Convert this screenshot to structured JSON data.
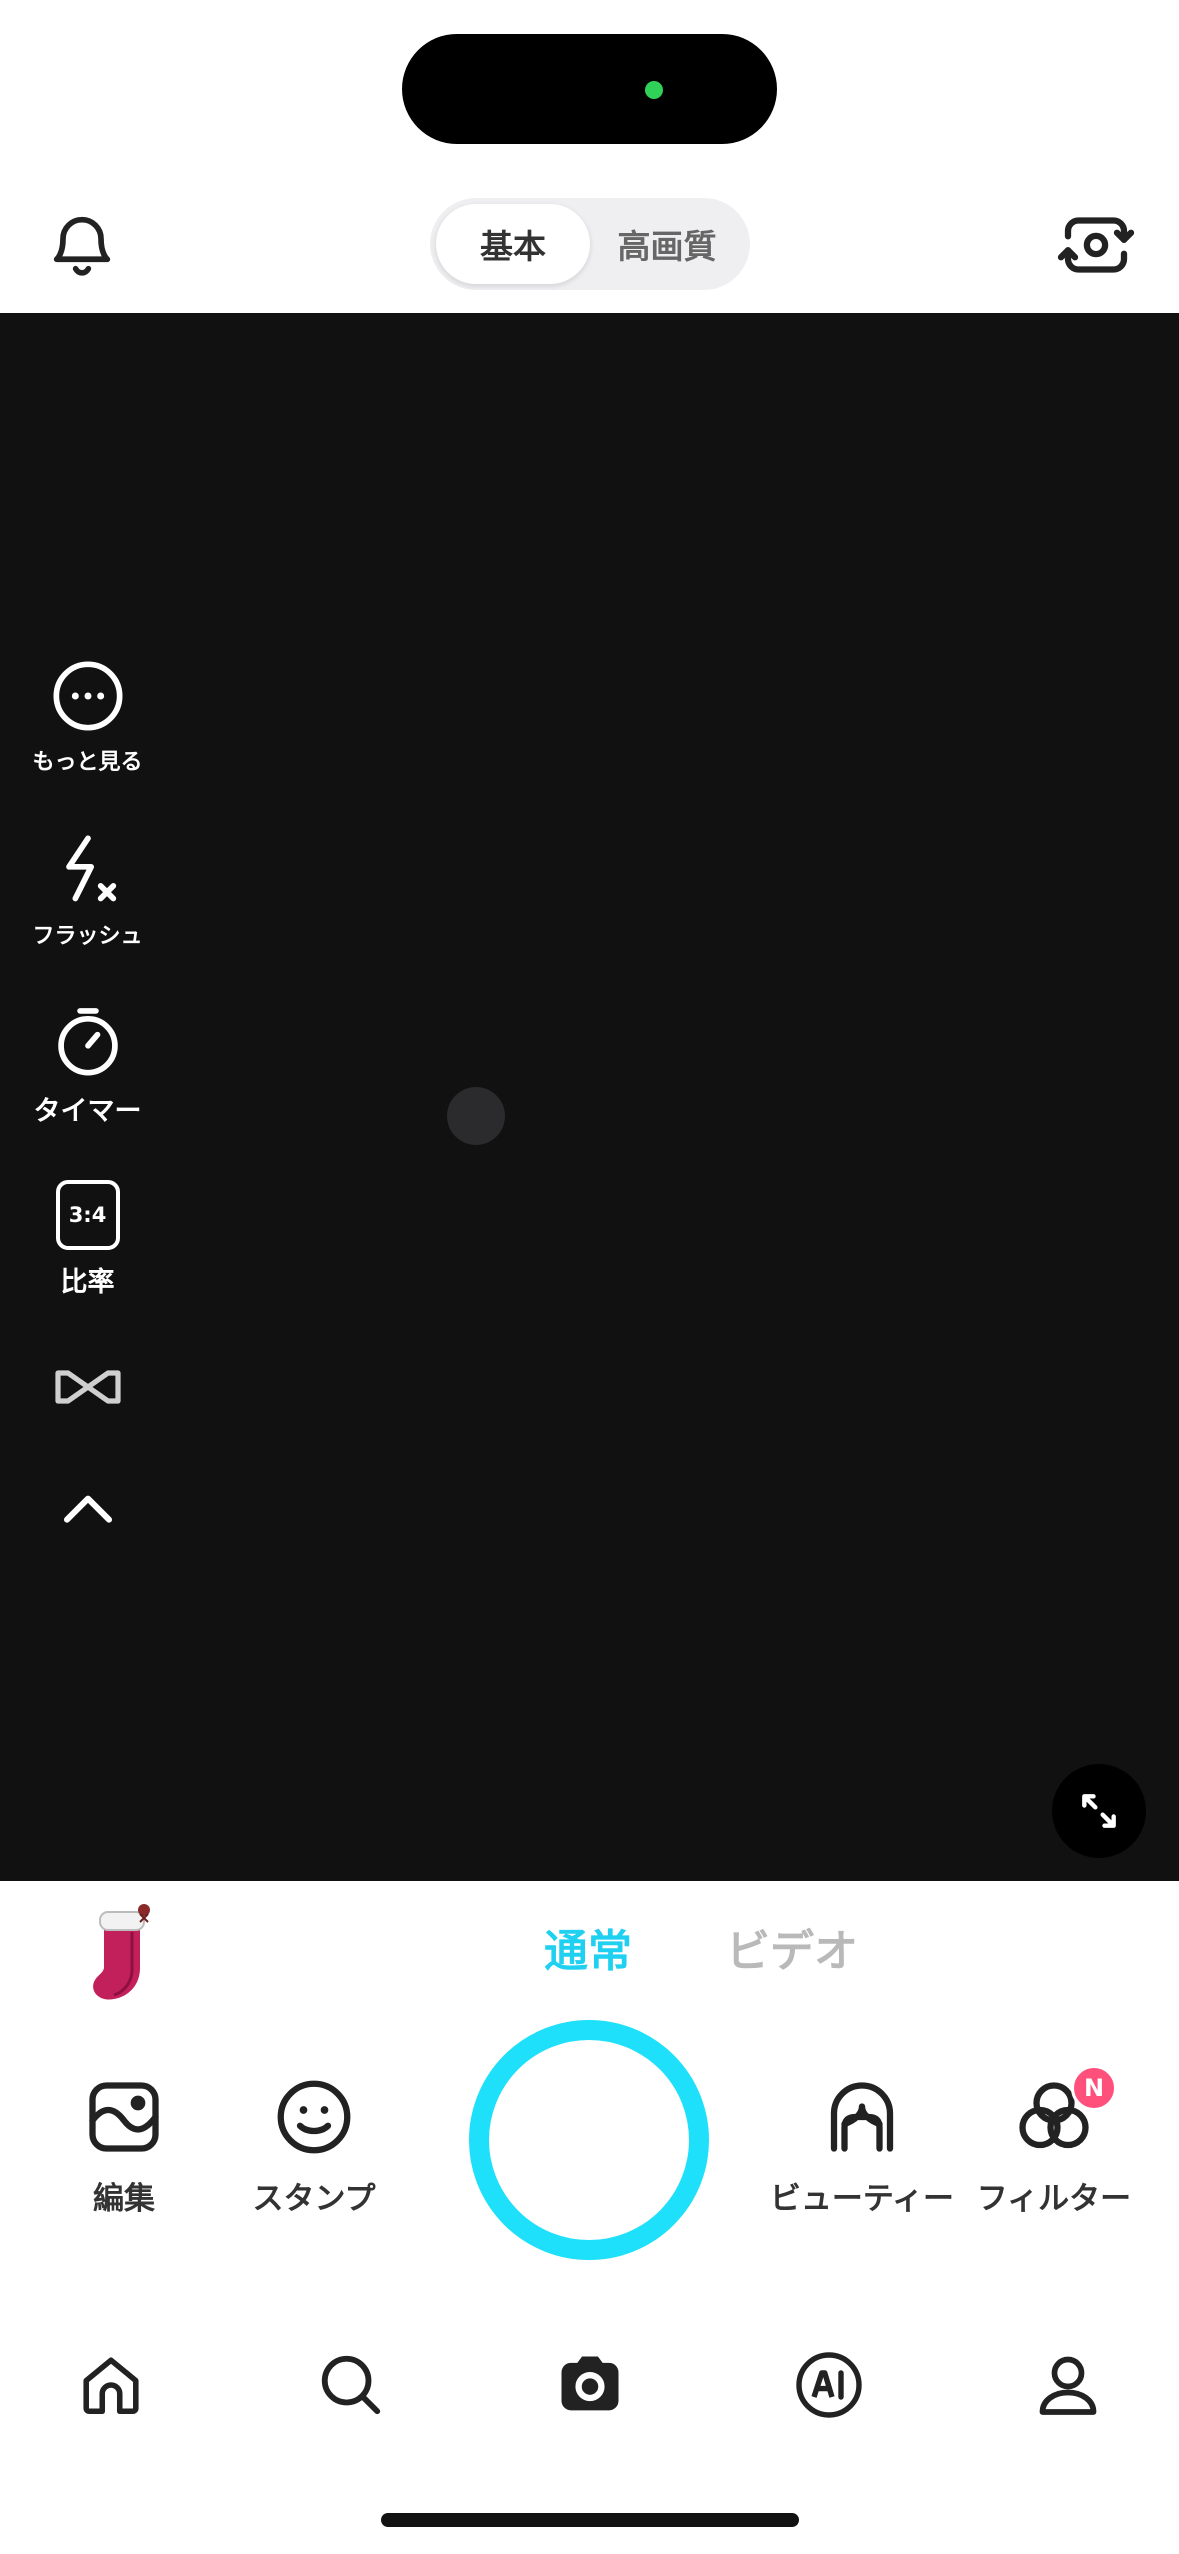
{
  "top_bar": {
    "quality": {
      "basic": "基本",
      "high": "高画質",
      "selected": "基本"
    }
  },
  "side_tools": {
    "more": "もっと見る",
    "flash": "フラッシュ",
    "timer": "タイマー",
    "ratio_value": "3:4",
    "ratio": "比率"
  },
  "modes": {
    "normal": "通常",
    "video": "ビデオ",
    "selected": "通常"
  },
  "tools": {
    "edit": "編集",
    "stamp": "スタンプ",
    "beauty": "ビューティー",
    "filter": "フィルター",
    "filter_badge": "N"
  },
  "colors": {
    "accent": "#1ee0fa",
    "accent_text": "#1fd0f0",
    "badge": "#ff4f7b",
    "viewfinder": "#111112"
  },
  "icons": {
    "top_left": "bell-icon",
    "top_right": "camera-flip-icon",
    "nav": [
      "home-icon",
      "search-icon",
      "camera-icon",
      "ai-icon",
      "profile-icon"
    ]
  }
}
